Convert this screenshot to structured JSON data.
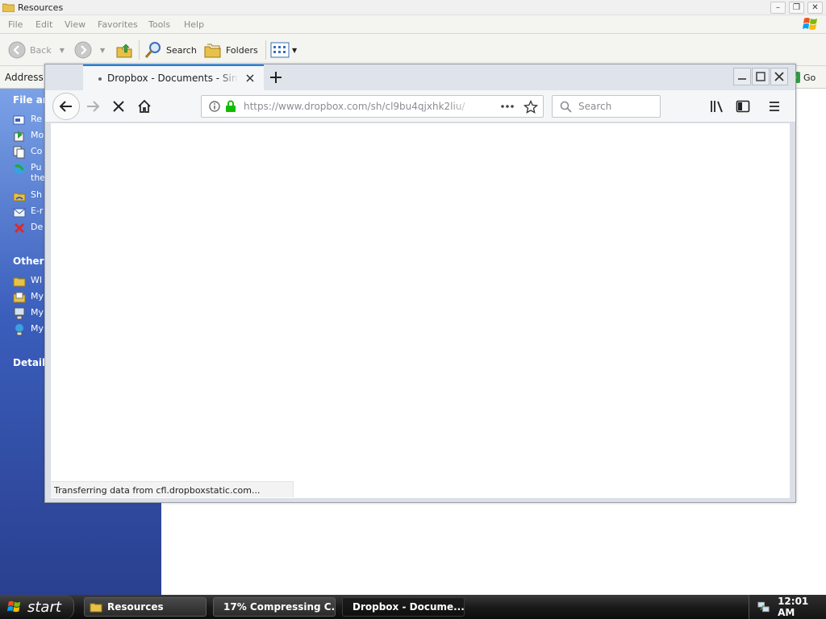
{
  "explorer": {
    "title": "Resources",
    "menu": [
      "File",
      "Edit",
      "View",
      "Favorites",
      "Tools",
      "Help"
    ],
    "toolbar": {
      "back": "Back",
      "search": "Search",
      "folders": "Folders"
    },
    "address_label": "Address",
    "go_label": "Go",
    "sidebar": {
      "file_tasks_heading": "File and",
      "file_tasks": [
        "Re",
        "Mo",
        "Co",
        "Pu",
        "Sh",
        "E-r",
        "De"
      ],
      "publish_second_line": "the",
      "other_places_heading": "Other I",
      "other_places": [
        "WI",
        "My",
        "My",
        "My"
      ],
      "details_heading": "Details"
    }
  },
  "firefox": {
    "tab_title": "Dropbox - Documents - Simplif",
    "url": "https://www.dropbox.com/sh/cl9bu4qjxhk2liu/",
    "search_placeholder": "Search",
    "status_text": "Transferring data from cfl.dropboxstatic.com..."
  },
  "taskbar": {
    "start_label": "start",
    "tasks": [
      {
        "label": "Resources",
        "icon": "folder-icon"
      },
      {
        "label": "17% Compressing C...",
        "icon": "7zip-icon"
      },
      {
        "label": "Dropbox - Docume...",
        "icon": "dropbox-icon",
        "active": true
      }
    ],
    "clock": "12:01 AM"
  }
}
